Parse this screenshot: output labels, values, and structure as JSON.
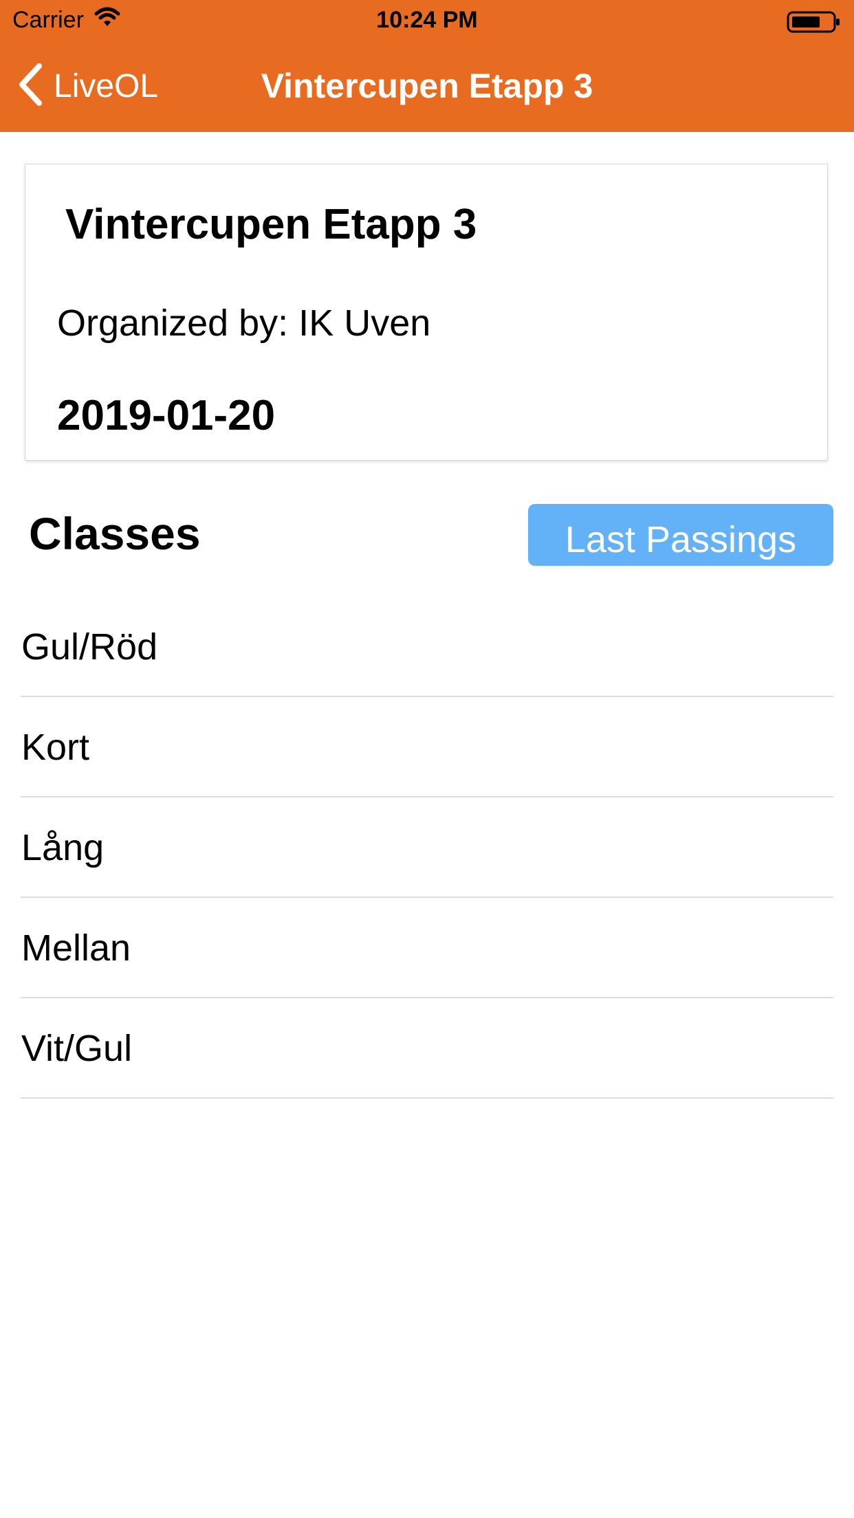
{
  "status_bar": {
    "carrier": "Carrier",
    "time": "10:24 PM"
  },
  "nav": {
    "back_label": "LiveOL",
    "title": "Vintercupen Etapp 3"
  },
  "event": {
    "name": "Vintercupen Etapp 3",
    "organizer": "Organized by: IK Uven",
    "date": "2019-01-20"
  },
  "classes": {
    "heading": "Classes",
    "last_passings_label": "Last Passings",
    "items": [
      {
        "label": "Gul/Röd"
      },
      {
        "label": "Kort"
      },
      {
        "label": "Lång"
      },
      {
        "label": "Mellan"
      },
      {
        "label": "Vit/Gul"
      }
    ]
  },
  "colors": {
    "header_bg": "#e86b22",
    "button_bg": "#63b1f6"
  },
  "icons": [
    "wifi-icon",
    "battery-icon",
    "chevron-left-icon"
  ]
}
